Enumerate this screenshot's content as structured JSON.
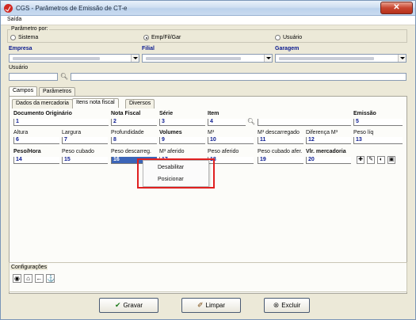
{
  "window": {
    "title": "CGS - Parâmetros de Emissão de CT-e",
    "close_glyph": "✕"
  },
  "menu": {
    "items": [
      "Saída"
    ]
  },
  "param_group": {
    "legend": "Parâmetro por:",
    "options": [
      "Sistema",
      "Emp/Fil/Gar",
      "Usuário"
    ],
    "selected": "Emp/Fil/Gar"
  },
  "fields": {
    "empresa_label": "Empresa",
    "filial_label": "Filial",
    "garagem_label": "Garagem",
    "usuario_label": "Usuário"
  },
  "outer_tabs": [
    "Campos",
    "Parâmetros"
  ],
  "inner_tabs": [
    "Dados da mercadoria",
    "Itens nota fiscal",
    "Diversos"
  ],
  "grid": {
    "row1": [
      {
        "label": "Documento Originário",
        "value": "1",
        "bold": true
      },
      {
        "label": "Nota Fiscal",
        "value": "2",
        "bold": true
      },
      {
        "label": "Série",
        "value": "3",
        "bold": true
      },
      {
        "label": "Item",
        "value": "4",
        "bold": true
      },
      {
        "label": "Emissão",
        "value": "5",
        "bold": true
      }
    ],
    "row2": [
      {
        "label": "Altura",
        "value": "6"
      },
      {
        "label": "Largura",
        "value": "7"
      },
      {
        "label": "Profundidade",
        "value": "8"
      },
      {
        "label": "Volumes",
        "value": "9",
        "bold": true
      },
      {
        "label": "M³",
        "value": "10"
      },
      {
        "label": "M³ descarregado",
        "value": "11"
      },
      {
        "label": "Diferença  M³",
        "value": "12"
      },
      {
        "label": "Peso líq",
        "value": "13"
      }
    ],
    "row3": [
      {
        "label": "Peso/Hora",
        "value": "14",
        "bold": true
      },
      {
        "label": "Peso cubado",
        "value": "15"
      },
      {
        "label": "Peso descarreg.",
        "value": "16"
      },
      {
        "label": "M³ aferido",
        "value": "17"
      },
      {
        "label": "Peso aferido",
        "value": "18"
      },
      {
        "label": "Peso cubado afer.",
        "value": "19"
      },
      {
        "label": "Vlr. mercadoria",
        "value": "20",
        "bold": true
      }
    ]
  },
  "context_menu": {
    "items": [
      "Desabilitar",
      "Posicionar"
    ]
  },
  "config": {
    "legend": "Configurações"
  },
  "buttons": {
    "save": "Gravar",
    "clear": "Limpar",
    "delete": "Excluir"
  },
  "colors": {
    "field_value": "#0a1a8f",
    "selection": "#3c65b8",
    "annotation": "#e02020"
  }
}
